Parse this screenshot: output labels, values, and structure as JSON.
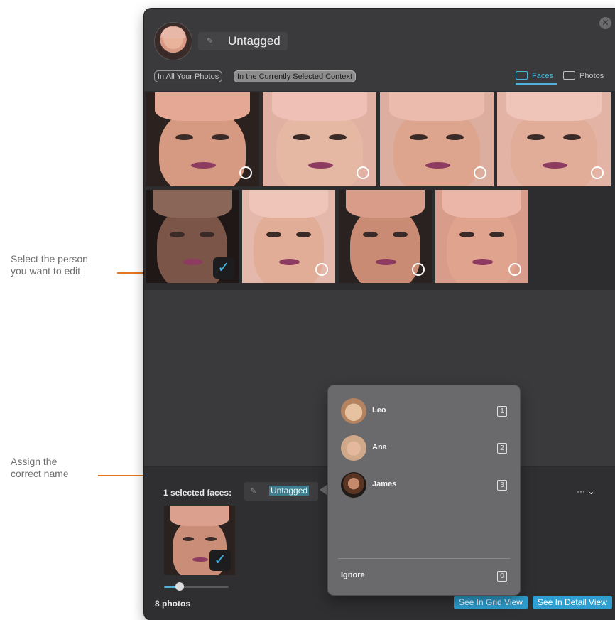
{
  "annotations": {
    "first": "Select the person you want to edit",
    "second": "Assign the correct name"
  },
  "header": {
    "name": "Untagged",
    "edit_icon": "edit-icon",
    "close_icon": "close-icon"
  },
  "scope_filters": [
    {
      "label": "In All Your Photos",
      "active": false
    },
    {
      "label": "In the Currently Selected Context",
      "active": true
    }
  ],
  "view_toggle": {
    "faces": "Faces",
    "photos": "Photos",
    "active": "Faces"
  },
  "grid": {
    "faces": [
      {
        "selected": false
      },
      {
        "selected": false
      },
      {
        "selected": false
      },
      {
        "selected": false
      },
      {
        "selected": true
      },
      {
        "selected": false
      },
      {
        "selected": false
      },
      {
        "selected": false
      }
    ]
  },
  "bottom": {
    "selected_label": "1 selected faces:",
    "name_value": "Untagged",
    "more": "··· ⌄",
    "photo_count": "8 photos",
    "grid_button": "See In Grid View",
    "detail_button": "See In Detail View",
    "zoom_level": 0.24
  },
  "popover": {
    "people": [
      {
        "name": "Leo",
        "key": "1"
      },
      {
        "name": "Ana",
        "key": "2"
      },
      {
        "name": "James",
        "key": "3"
      }
    ],
    "ignore": {
      "label": "Ignore",
      "key": "0"
    }
  },
  "colors": {
    "accent": "#4fb3d8",
    "annotation": "#e8761e",
    "window": "#3a3a3c"
  }
}
